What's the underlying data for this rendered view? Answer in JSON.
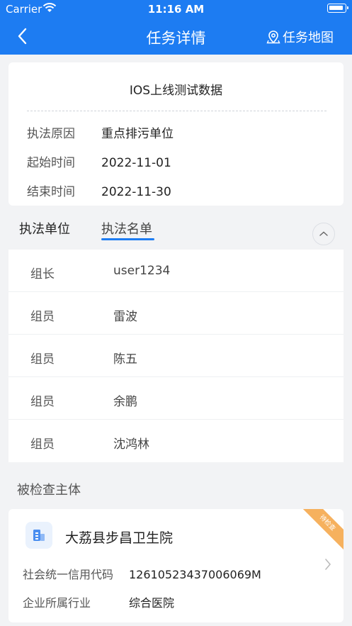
{
  "status_bar": {
    "carrier": "Carrier",
    "time": "11:16 AM"
  },
  "navbar": {
    "title": "任务详情",
    "map_link": "任务地图",
    "accent": "#1d7cf2"
  },
  "task": {
    "title": "IOS上线测试数据",
    "fields": [
      {
        "label": "执法原因",
        "value": "重点排污单位"
      },
      {
        "label": "起始时间",
        "value": "2022-11-01"
      },
      {
        "label": "结束时间",
        "value": "2022-11-30"
      }
    ]
  },
  "tabs": [
    {
      "label": "执法单位"
    },
    {
      "label": "执法名单"
    }
  ],
  "members": [
    {
      "role": "组长",
      "name": "user1234"
    },
    {
      "role": "组员",
      "name": "雷波"
    },
    {
      "role": "组员",
      "name": "陈五"
    },
    {
      "role": "组员",
      "name": "余鹏"
    },
    {
      "role": "组员",
      "name": "沈鸿林"
    }
  ],
  "inspected": {
    "section_title": "被检查主体",
    "ribbon": "待检查",
    "name": "大荔县步昌卫生院",
    "fields": [
      {
        "label": "社会统一信用代码",
        "value": "12610523437006069M"
      },
      {
        "label": "企业所属行业",
        "value": "综合医院"
      }
    ]
  },
  "icons": {
    "back": "chevron-left-icon",
    "map": "map-pin-icon",
    "collapse": "chevron-up-icon",
    "entity": "building-icon",
    "detail": "chevron-right-icon"
  }
}
